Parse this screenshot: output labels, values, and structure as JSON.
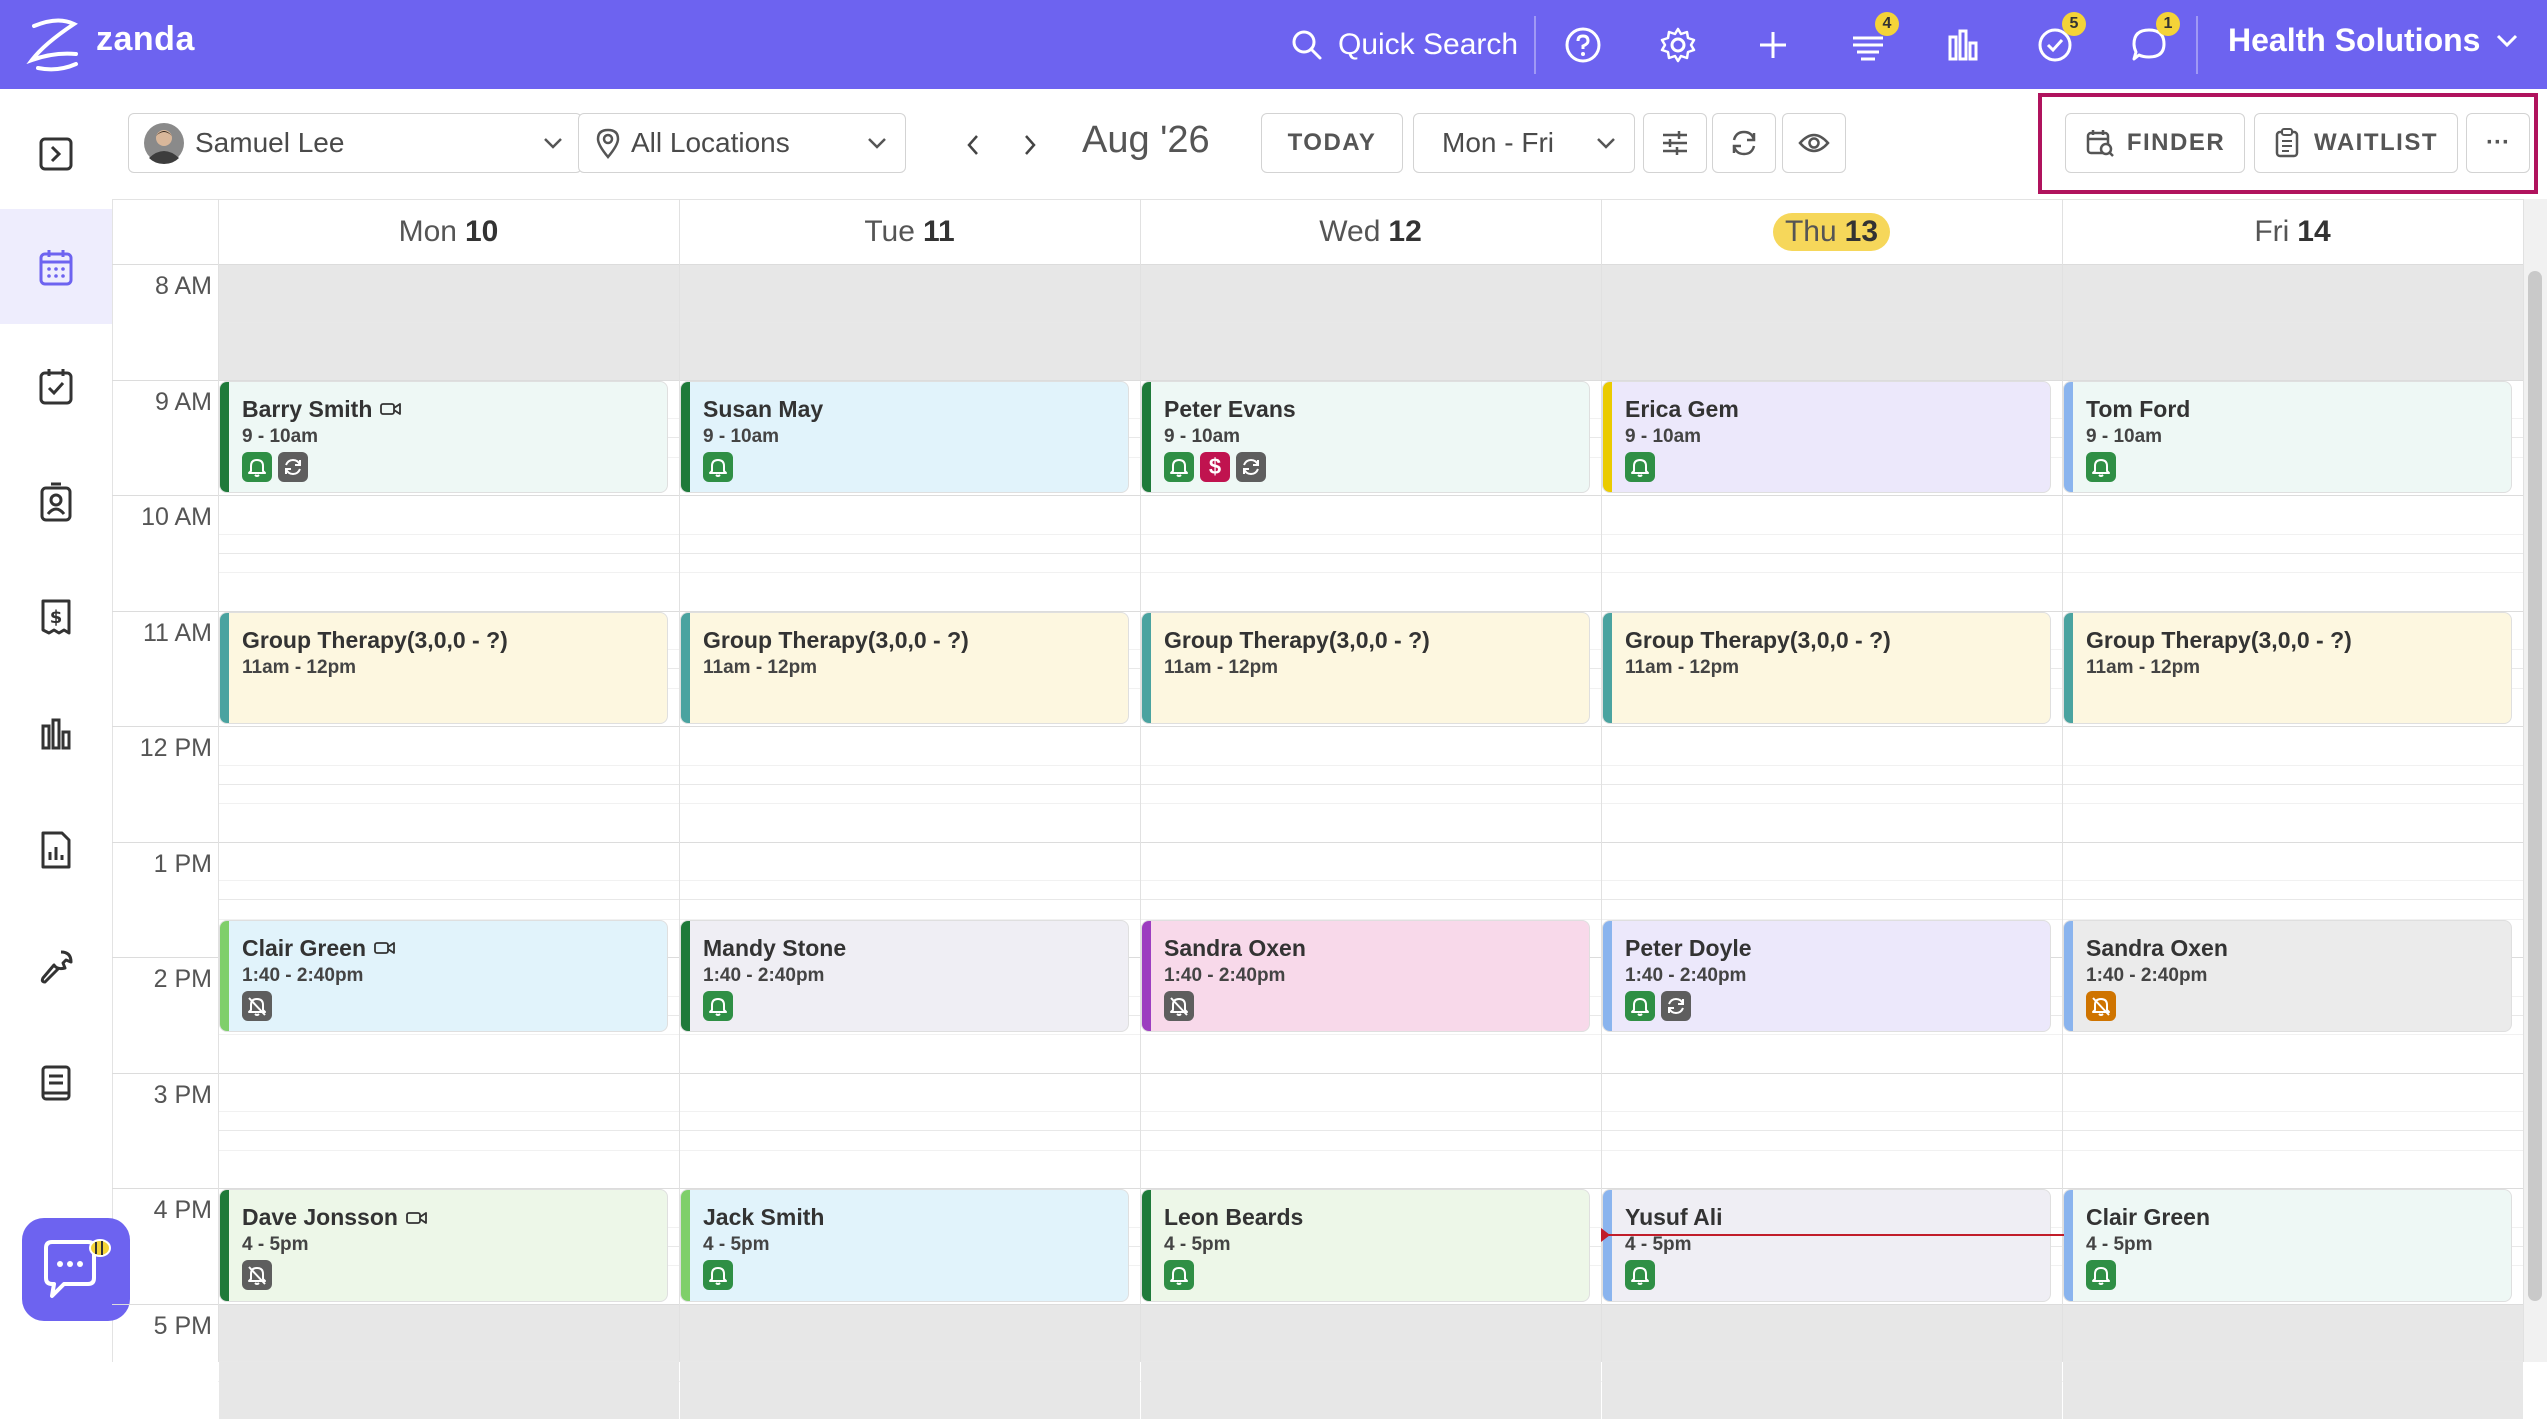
{
  "app": {
    "brand": "zanda",
    "quick_search": "Quick Search",
    "organization": "Health Solutions",
    "badges": {
      "tasks": "4",
      "checklist": "5",
      "messages": "1"
    },
    "accent_color": "#6d63f0"
  },
  "toolbar": {
    "practitioner": "Samuel Lee",
    "location": "All Locations",
    "month": "Aug '26",
    "today_label": "TODAY",
    "range": "Mon - Fri",
    "finder_label": "FINDER",
    "waitlist_label": "WAITLIST",
    "more_label": "···"
  },
  "days": [
    {
      "name": "Mon",
      "num": "10"
    },
    {
      "name": "Tue",
      "num": "11"
    },
    {
      "name": "Wed",
      "num": "12"
    },
    {
      "name": "Thu",
      "num": "13",
      "today": true
    },
    {
      "name": "Fri",
      "num": "14"
    }
  ],
  "hours": [
    "8 AM",
    "9 AM",
    "10 AM",
    "11 AM",
    "12 PM",
    "1 PM",
    "2 PM",
    "3 PM",
    "4 PM",
    "5 PM"
  ],
  "appointments": [
    {
      "day": 0,
      "start": 9,
      "end": 10,
      "name": "Barry Smith",
      "time": "9 - 10am",
      "video": true,
      "bar": "#1f7a3a",
      "bg": "#eef8f5",
      "icons": [
        "bell",
        "rep"
      ]
    },
    {
      "day": 1,
      "start": 9,
      "end": 10,
      "name": "Susan May",
      "time": "9 - 10am",
      "bar": "#1f7a3a",
      "bg": "#e1f3fb",
      "icons": [
        "bell"
      ]
    },
    {
      "day": 2,
      "start": 9,
      "end": 10,
      "name": "Peter Evans",
      "time": "9 - 10am",
      "bar": "#1f7a3a",
      "bg": "#eef8f5",
      "icons": [
        "bell",
        "dollar",
        "rep"
      ]
    },
    {
      "day": 3,
      "start": 9,
      "end": 10,
      "name": "Erica Gem",
      "time": "9 - 10am",
      "bar": "#eacb00",
      "bg": "#ece8fb",
      "icons": [
        "bell"
      ]
    },
    {
      "day": 4,
      "start": 9,
      "end": 10,
      "name": "Tom Ford",
      "time": "9 - 10am",
      "bar": "#8ab4ee",
      "bg": "#eef8f5",
      "icons": [
        "bell"
      ]
    },
    {
      "day": 0,
      "start": 11,
      "end": 12,
      "name": "Group Therapy(3,0,0 - ?)",
      "time": "11am - 12pm",
      "bar": "#4aa3a0",
      "bg": "#fdf7e0",
      "icons": []
    },
    {
      "day": 1,
      "start": 11,
      "end": 12,
      "name": "Group Therapy(3,0,0 - ?)",
      "time": "11am - 12pm",
      "bar": "#4aa3a0",
      "bg": "#fdf7e0",
      "icons": []
    },
    {
      "day": 2,
      "start": 11,
      "end": 12,
      "name": "Group Therapy(3,0,0 - ?)",
      "time": "11am - 12pm",
      "bar": "#4aa3a0",
      "bg": "#fdf7e0",
      "icons": []
    },
    {
      "day": 3,
      "start": 11,
      "end": 12,
      "name": "Group Therapy(3,0,0 - ?)",
      "time": "11am - 12pm",
      "bar": "#4aa3a0",
      "bg": "#fdf7e0",
      "icons": []
    },
    {
      "day": 4,
      "start": 11,
      "end": 12,
      "name": "Group Therapy(3,0,0 - ?)",
      "time": "11am - 12pm",
      "bar": "#4aa3a0",
      "bg": "#fdf7e0",
      "icons": []
    },
    {
      "day": 0,
      "start": 13.667,
      "end": 14.667,
      "name": "Clair Green",
      "time": "1:40 - 2:40pm",
      "video": true,
      "bar": "#7fcf6a",
      "bg": "#e1f3fb",
      "icons": [
        "mute"
      ]
    },
    {
      "day": 1,
      "start": 13.667,
      "end": 14.667,
      "name": "Mandy Stone",
      "time": "1:40 - 2:40pm",
      "bar": "#1f7a3a",
      "bg": "#efeef4",
      "icons": [
        "bell"
      ]
    },
    {
      "day": 2,
      "start": 13.667,
      "end": 14.667,
      "name": "Sandra Oxen",
      "time": "1:40 - 2:40pm",
      "bar": "#9c3ec0",
      "bg": "#f8d9ea",
      "icons": [
        "mute"
      ]
    },
    {
      "day": 3,
      "start": 13.667,
      "end": 14.667,
      "name": "Peter Doyle",
      "time": "1:40 - 2:40pm",
      "bar": "#8ab4ee",
      "bg": "#ece8fb",
      "icons": [
        "bell",
        "rep"
      ]
    },
    {
      "day": 4,
      "start": 13.667,
      "end": 14.667,
      "name": "Sandra Oxen",
      "time": "1:40 - 2:40pm",
      "bar": "#8ab4ee",
      "bg": "#ebebeb",
      "icons": [
        "mute-o"
      ]
    },
    {
      "day": 0,
      "start": 16,
      "end": 17,
      "name": "Dave Jonsson",
      "time": "4 - 5pm",
      "video": true,
      "bar": "#1f7a3a",
      "bg": "#edf7e8",
      "icons": [
        "mute"
      ]
    },
    {
      "day": 1,
      "start": 16,
      "end": 17,
      "name": "Jack Smith",
      "time": "4 - 5pm",
      "bar": "#7fcf6a",
      "bg": "#e1f3fb",
      "icons": [
        "bell"
      ]
    },
    {
      "day": 2,
      "start": 16,
      "end": 17,
      "name": "Leon Beards",
      "time": "4 - 5pm",
      "bar": "#1f7a3a",
      "bg": "#edf7e8",
      "icons": [
        "bell"
      ]
    },
    {
      "day": 3,
      "start": 16,
      "end": 17,
      "name": "Yusuf Ali",
      "time": "4 - 5pm",
      "bar": "#8ab4ee",
      "bg": "#efeef4",
      "icons": [
        "bell"
      ]
    },
    {
      "day": 4,
      "start": 16,
      "end": 17,
      "name": "Clair Green",
      "time": "4 - 5pm",
      "bar": "#8ab4ee",
      "bg": "#eef8f5",
      "icons": [
        "bell"
      ]
    }
  ],
  "now_hour": 16.4
}
